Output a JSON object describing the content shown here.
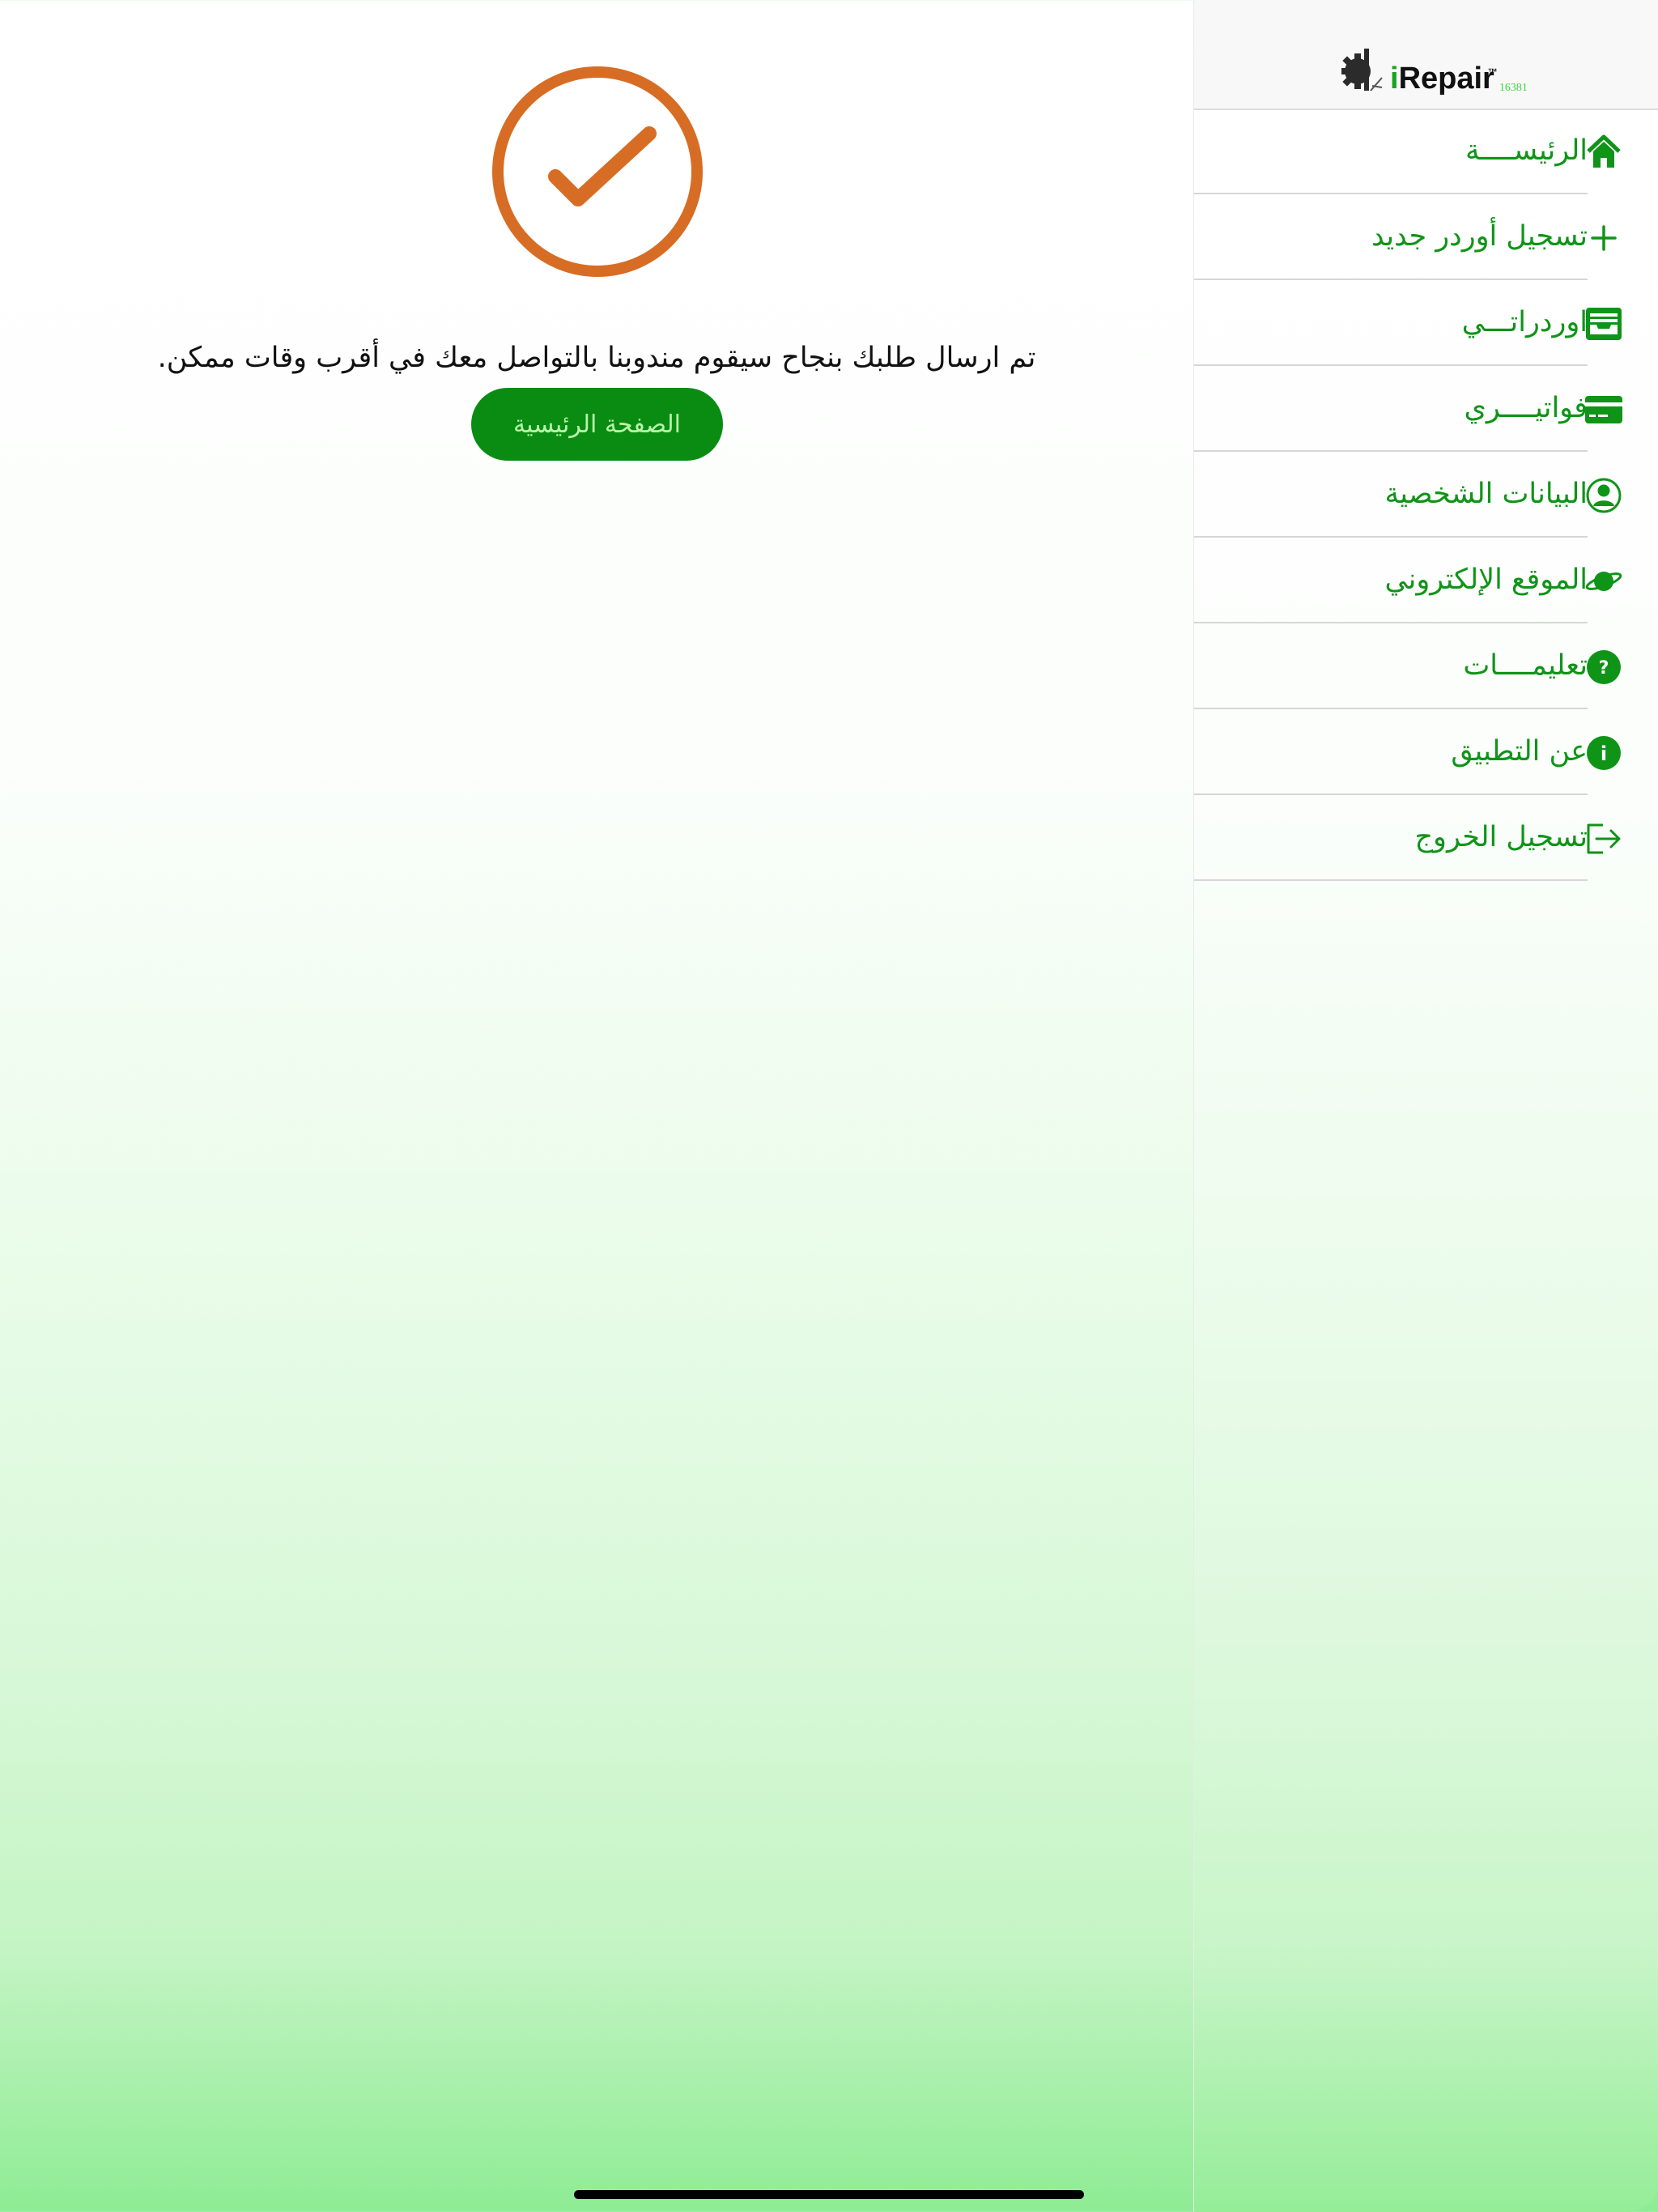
{
  "main": {
    "message": "تم ارسال طلبك بنجاح سيقوم مندوبنا بالتواصل معك في أقرب وقات ممكن.",
    "home_button_label": "الصفحة الرئيسية",
    "check_icon": "check-circle-icon",
    "check_color": "#d76d24"
  },
  "sidebar": {
    "logo": {
      "i": "i",
      "text": "Repair",
      "tm": "™",
      "number": "16381"
    },
    "accent_color": "#0f9418",
    "items": [
      {
        "label": "الرئيســــة",
        "icon": "home-icon"
      },
      {
        "label": "تسجيل أوردر جديد",
        "icon": "plus-icon"
      },
      {
        "label": "اوردراتـــي",
        "icon": "inbox-icon"
      },
      {
        "label": "فواتيــــري",
        "icon": "credit-card-icon"
      },
      {
        "label": "البيانات الشخصية",
        "icon": "user-icon"
      },
      {
        "label": "الموقع الإلكتروني",
        "icon": "planet-icon"
      },
      {
        "label": "تعليمــــات",
        "icon": "question-icon"
      },
      {
        "label": "عن التطبيق",
        "icon": "info-icon"
      },
      {
        "label": "تسجيل الخروج",
        "icon": "logout-icon"
      }
    ]
  }
}
